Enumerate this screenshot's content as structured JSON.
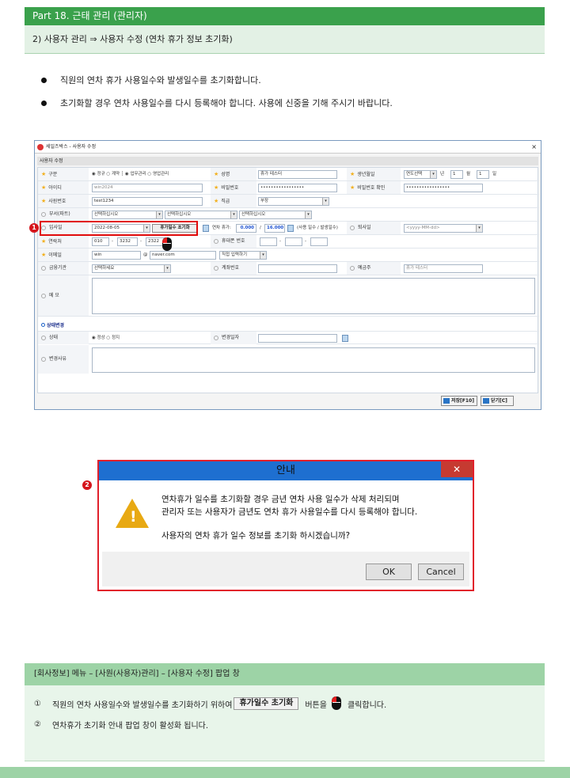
{
  "header": {
    "part_title": "Part 18. 근태 관리 (관리자)",
    "subtitle": "2) 사용자 관리 ⇒ 사용자 수정 (연차 휴가 정보 초기화)"
  },
  "bullets": [
    "직원의 연차 휴가 사용일수와 발생일수를 초기화합니다.",
    "초기화할 경우 연차 사용일수를 다시 등록해야 합니다. 사용에 신중을 기해 주시기 바랍니다."
  ],
  "window": {
    "title": "세일즈박스 - 사용자 수정",
    "close": "×",
    "section": "사용자 수정",
    "labels": {
      "type": "구분",
      "name": "성명",
      "birthday": "생년월일",
      "id": "아이디",
      "password": "비밀번호",
      "password_confirm": "비밀번호 확인",
      "emp_no": "사원번호",
      "position": "직급",
      "dept": "부서(파트)",
      "join_date": "입사일",
      "leave_date": "퇴사일",
      "contact": "연락처",
      "mobile": "휴대폰 번호",
      "email": "이메일",
      "bank": "금융기관",
      "account": "계좌번호",
      "holder": "예금주",
      "memo": "메 모",
      "state_change": "상태변경",
      "status": "상태",
      "change_date": "변경일자",
      "change_reason": "변경사유"
    },
    "values": {
      "type_opts": "◉ 정규 ○ 계약 ┆ ◉ 업무관리 ○ 영업관리",
      "name": "휴가 테스터",
      "birth_select": "연도선택",
      "birth_nyeon": "년",
      "birth_month": "1",
      "birth_wol": "월",
      "birth_day": "1",
      "birth_il": "일",
      "id": "win2024",
      "password": "•••••••••••••••••",
      "password_confirm": "•••••••••••••••••",
      "emp_no": "test1234",
      "position": "부장",
      "dept1": "선택하십시오",
      "dept2": "선택하십시오",
      "dept3": "선택하십시오",
      "join_date": "2022-08-05",
      "reset_btn": "휴가일수 초기화",
      "leave_prefix": "연차 휴가:",
      "leave_used": "0.000",
      "leave_sep": "/",
      "leave_total": "16.000",
      "leave_note": "(사용 일수 / 발생일수)",
      "leave_date_placeholder": "<yyyy-MM-dd>",
      "phone1": "010",
      "phone2": "3232",
      "phone3": "2322",
      "dash": "-",
      "email_id": "win",
      "at": "@",
      "email_domain": "naver.com",
      "email_select": "직접 입력하기",
      "bank": "선택하세요",
      "holder": "휴가 테스터",
      "status_opts": "◉ 정상 ○ 정지"
    },
    "buttons": {
      "save": "저장[F10]",
      "close": "닫기[C]"
    }
  },
  "badges": {
    "one": "1",
    "two": "2"
  },
  "dialog": {
    "title": "안내",
    "close": "✕",
    "line1": "연차휴가 일수를 초기화할 경우 금년 연차 사용 일수가 삭제 처리되며",
    "line2": "관리자 또는 사용자가  금년도  연차 휴가 사용일수를 다시 등록해야 합니다.",
    "line3": "사용자의 연차 휴가 일수 정보를 초기화 하시겠습니까?",
    "ok": "OK",
    "cancel": "Cancel"
  },
  "note": {
    "head": "[회사정보] 메뉴 – [사원(사용자)관리] – [사용자 수정] 팝업 창",
    "l1_num": "①",
    "l1_a": "직원의 연차 사용일수와 발생일수를 초기화하기 위하여",
    "l1_btn": "휴가일수 초기화",
    "l1_b": "버튼을",
    "l1_c": "클릭합니다.",
    "l2_num": "②",
    "l2": "연차휴가  초기화 안내 팝업 창이 활성화 됩니다."
  },
  "icons": {
    "star": "star-icon",
    "mouse": "mouse-icon",
    "warning": "warning-icon",
    "calendar": "calendar-icon"
  },
  "colors": {
    "green": "#3aa14c",
    "red": "#e10b0b",
    "blue": "#1e6fd0",
    "warning": "#e8a913"
  }
}
